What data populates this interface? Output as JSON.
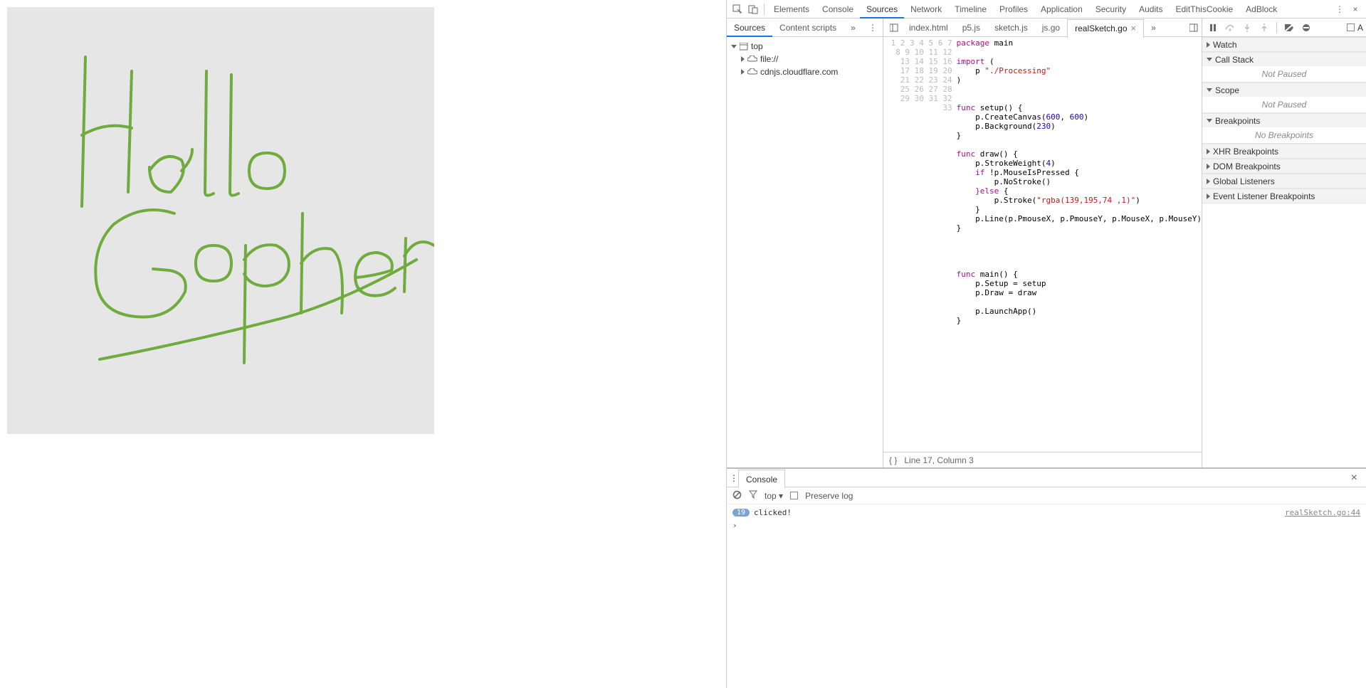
{
  "devtools": {
    "topTabs": [
      "Elements",
      "Console",
      "Sources",
      "Network",
      "Timeline",
      "Profiles",
      "Application",
      "Security",
      "Audits",
      "EditThisCookie",
      "AdBlock"
    ],
    "activeTopTab": "Sources"
  },
  "sourcesPanel": {
    "leftTabs": [
      "Sources",
      "Content scripts"
    ],
    "activeLeftTab": "Sources",
    "tree": {
      "root": "top",
      "children": [
        "file://",
        "cdnjs.cloudflare.com"
      ]
    },
    "fileTabs": [
      "index.html",
      "p5.js",
      "sketch.js",
      "js.go",
      "realSketch.go"
    ],
    "activeFileTab": "realSketch.go",
    "statusbar": "Line 17, Column 3"
  },
  "code": {
    "lines": 33,
    "l1a": "package",
    "l1b": " main",
    "l3a": "import",
    "l3b": " (",
    "l4a": "    p ",
    "l4b": "\"./Processing\"",
    "l5": ")",
    "l8a": "func",
    "l8b": " setup() {",
    "l9a": "    p.CreateCanvas(",
    "l9b": "600",
    "l9c": ", ",
    "l9d": "600",
    "l9e": ")",
    "l10a": "    p.Background(",
    "l10b": "230",
    "l10c": ")",
    "l11": "}",
    "l13a": "func",
    "l13b": " draw() {",
    "l14a": "    p.StrokeWeight(",
    "l14b": "4",
    "l14c": ")",
    "l15a": "    ",
    "l15b": "if",
    "l15c": " !p.MouseIsPressed {",
    "l16": "        p.NoStroke()",
    "l17a": "    }",
    "l17b": "else",
    "l17c": " {",
    "l18a": "        p.Stroke(",
    "l18b": "\"rgba(139,195,74 ,1)\"",
    "l18c": ")",
    "l19": "    }",
    "l20": "    p.Line(p.PmouseX, p.PmouseY, p.MouseX, p.MouseY)",
    "l21": "}",
    "l27a": "func",
    "l27b": " main() {",
    "l28": "    p.Setup = setup",
    "l29": "    p.Draw = draw",
    "l31": "    p.LaunchApp()",
    "l32": "}"
  },
  "debugger": {
    "sections": {
      "watch": "Watch",
      "callstack": "Call Stack",
      "callstack_body": "Not Paused",
      "scope": "Scope",
      "scope_body": "Not Paused",
      "breakpoints": "Breakpoints",
      "breakpoints_body": "No Breakpoints",
      "xhr": "XHR Breakpoints",
      "dom": "DOM Breakpoints",
      "global": "Global Listeners",
      "event": "Event Listener Breakpoints"
    }
  },
  "console": {
    "tab": "Console",
    "context": "top",
    "preserve": "Preserve log",
    "badge": "19",
    "msg": "clicked!",
    "src": "realSketch.go:44"
  },
  "icons": {
    "more": "⋮",
    "chevrons": "»",
    "close": "×",
    "tri_down": "▾"
  }
}
